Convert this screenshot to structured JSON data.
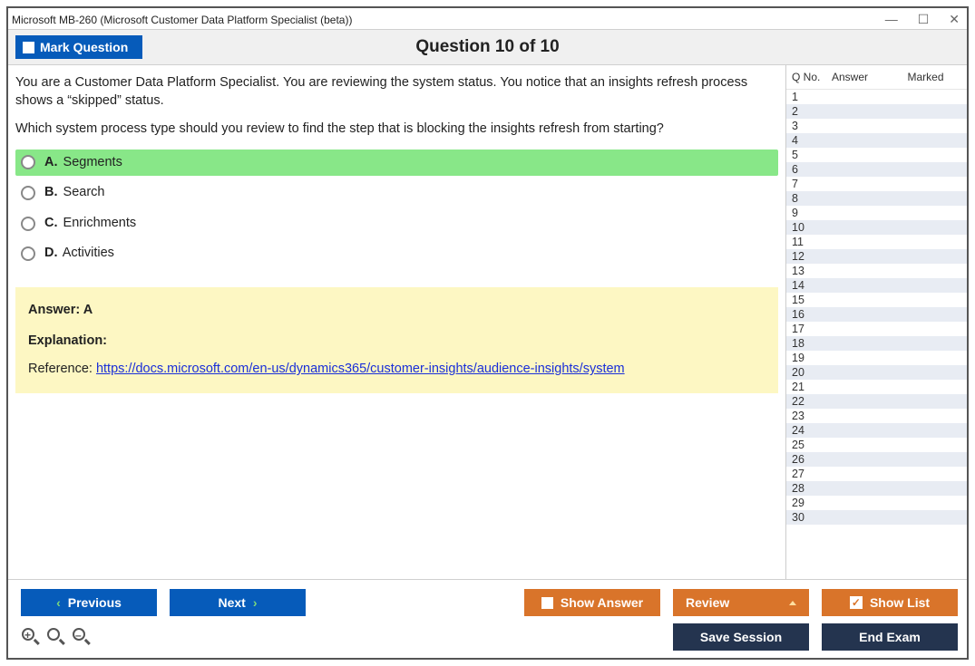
{
  "window": {
    "title": "Microsoft MB-260 (Microsoft Customer Data Platform Specialist (beta))"
  },
  "header": {
    "mark_label": "Mark Question",
    "progress": "Question 10 of 10"
  },
  "question": {
    "para1": "You are a Customer Data Platform Specialist. You are reviewing the system status. You notice that an insights refresh process shows a “skipped” status.",
    "para2": "Which system process type should you review to find the step that is blocking the insights refresh from starting?"
  },
  "options": [
    {
      "letter": "A.",
      "text": "Segments",
      "correct": true
    },
    {
      "letter": "B.",
      "text": "Search",
      "correct": false
    },
    {
      "letter": "C.",
      "text": "Enrichments",
      "correct": false
    },
    {
      "letter": "D.",
      "text": "Activities",
      "correct": false
    }
  ],
  "answer": {
    "line": "Answer: A",
    "exp_label": "Explanation:",
    "ref_prefix": "Reference: ",
    "ref_url": "https://docs.microsoft.com/en-us/dynamics365/customer-insights/audience-insights/system"
  },
  "sidepanel": {
    "col_qno": "Q No.",
    "col_answer": "Answer",
    "col_marked": "Marked",
    "rows": 30
  },
  "footer": {
    "previous": "Previous",
    "next": "Next",
    "show_answer": "Show Answer",
    "review": "Review",
    "show_list": "Show List",
    "save_session": "Save Session",
    "end_exam": "End Exam"
  }
}
